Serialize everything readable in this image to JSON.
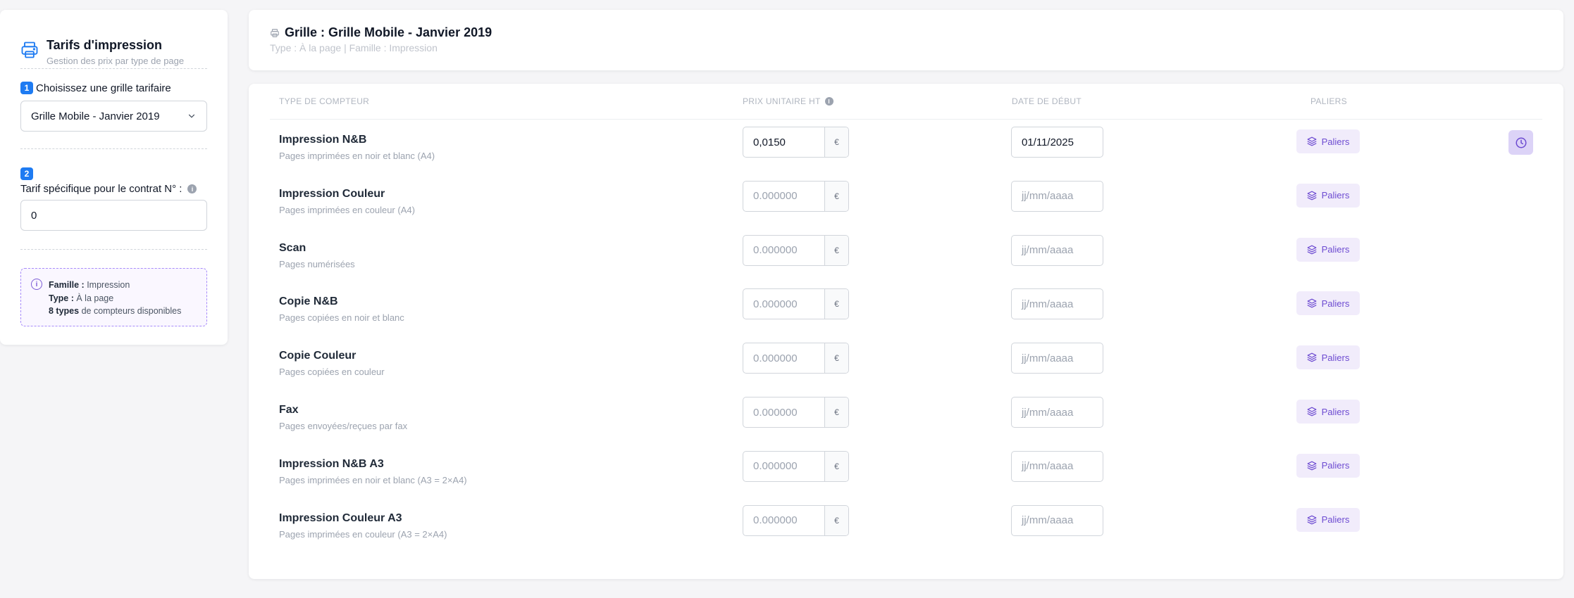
{
  "sidebar": {
    "title": "Tarifs d'impression",
    "subtitle": "Gestion des prix par type de page",
    "step1": {
      "number": "1",
      "label": "Choisissez une grille tarifaire"
    },
    "grid_select": {
      "value": "Grille Mobile - Janvier 2019"
    },
    "step2": {
      "number": "2",
      "label": "Tarif spécifique pour le contrat N° :"
    },
    "contract_input": {
      "value": "0"
    },
    "info": {
      "famille_label": "Famille :",
      "famille_value": "Impression",
      "type_label": "Type :",
      "type_value": "À la page",
      "types_count": "8 types",
      "types_suffix": "de compteurs disponibles"
    }
  },
  "header": {
    "title": "Grille : Grille Mobile - Janvier 2019",
    "subtitle": "Type : À la page | Famille : Impression"
  },
  "table": {
    "columns": {
      "type": "TYPE DE COMPTEUR",
      "price": "PRIX UNITAIRE HT",
      "date": "DATE DE DÉBUT",
      "tiers": "PALIERS"
    },
    "currency": "€",
    "tiers_button": "Paliers",
    "rows": [
      {
        "name": "Impression N&B",
        "desc": "Pages imprimées en noir et blanc (A4)",
        "price": "0,0150",
        "price_placeholder": "",
        "date": "01/11/2025",
        "date_placeholder": ""
      },
      {
        "name": "Impression Couleur",
        "desc": "Pages imprimées en couleur (A4)",
        "price": "",
        "price_placeholder": "0.000000",
        "date": "",
        "date_placeholder": "jj/mm/aaaa"
      },
      {
        "name": "Scan",
        "desc": "Pages numérisées",
        "price": "",
        "price_placeholder": "0.000000",
        "date": "",
        "date_placeholder": "jj/mm/aaaa"
      },
      {
        "name": "Copie N&B",
        "desc": "Pages copiées en noir et blanc",
        "price": "",
        "price_placeholder": "0.000000",
        "date": "",
        "date_placeholder": "jj/mm/aaaa"
      },
      {
        "name": "Copie Couleur",
        "desc": "Pages copiées en couleur",
        "price": "",
        "price_placeholder": "0.000000",
        "date": "",
        "date_placeholder": "jj/mm/aaaa"
      },
      {
        "name": "Fax",
        "desc": "Pages envoyées/reçues par fax",
        "price": "",
        "price_placeholder": "0.000000",
        "date": "",
        "date_placeholder": "jj/mm/aaaa"
      },
      {
        "name": "Impression N&B A3",
        "desc": "Pages imprimées en noir et blanc (A3 = 2×A4)",
        "price": "",
        "price_placeholder": "0.000000",
        "date": "",
        "date_placeholder": "jj/mm/aaaa"
      },
      {
        "name": "Impression Couleur A3",
        "desc": "Pages imprimées en couleur (A3 = 2×A4)",
        "price": "",
        "price_placeholder": "0.000000",
        "date": "",
        "date_placeholder": "jj/mm/aaaa"
      }
    ]
  },
  "icons": {
    "sidebar_logo": "printer-icon",
    "header_icon": "printer-icon",
    "select_arrow": "chevron-down-icon",
    "info": "info-icon",
    "tiers": "layers-icon",
    "history": "clock-icon"
  },
  "colors": {
    "accent_blue": "#1e7bf2",
    "accent_purple": "#6d4bd1",
    "paliers_bg": "#f1ecfb",
    "info_border": "#a78bfa"
  }
}
